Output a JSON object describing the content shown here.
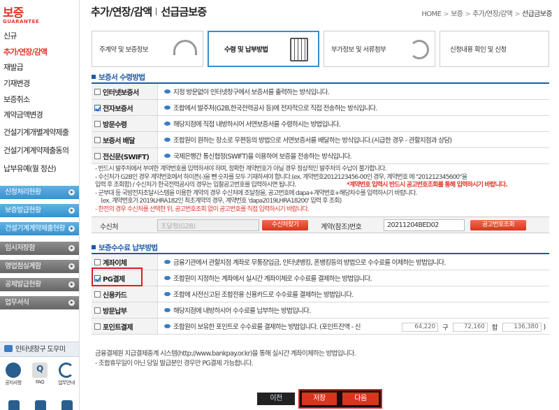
{
  "logo": {
    "main": "보증",
    "sub": "GUARANTEE"
  },
  "nav": [
    {
      "label": "신규",
      "active": false
    },
    {
      "label": "추가/연장/감액",
      "active": true
    },
    {
      "label": "재발급",
      "active": false
    },
    {
      "label": "기재변경",
      "active": false
    },
    {
      "label": "보증취소",
      "active": false
    },
    {
      "label": "계약금액변경",
      "active": false
    },
    {
      "label": "건설기계개별계약제출",
      "active": false
    },
    {
      "label": "건설기계계약제출동의",
      "active": false
    },
    {
      "label": "납부유예(월 정산)",
      "active": false
    }
  ],
  "side_buttons": [
    {
      "label": "신청처리현황",
      "style": "blue"
    },
    {
      "label": "보증발급현황",
      "style": "blue"
    },
    {
      "label": "건설기계계약제출현황",
      "style": "blue"
    },
    {
      "label": "임시저장함",
      "style": "gray"
    },
    {
      "label": "영업점실계함",
      "style": "gray"
    },
    {
      "label": "공제발급현황",
      "style": "gray"
    },
    {
      "label": "업무서식",
      "style": "gray"
    }
  ],
  "help": {
    "title": "인터넷창구 도우미",
    "icons": [
      {
        "label": "공지사항",
        "icon": "notice-icon"
      },
      {
        "label": "FAQ",
        "icon": "faq-icon"
      },
      {
        "label": "업무안내",
        "icon": "guide-icon"
      }
    ]
  },
  "header": {
    "title": "추가/연장/감액",
    "subtitle": "선급금보증",
    "breadcrumb": [
      "HOME",
      "보증",
      "추가/연장/감액",
      "선급금보증"
    ]
  },
  "steps": [
    {
      "label": "주계약 및 보증정보",
      "icon": "headset-icon",
      "current": false
    },
    {
      "label": "수령 및 납부방법",
      "icon": "calculator-icon",
      "current": true
    },
    {
      "label": "부가정보 및 서류첨부",
      "icon": "refresh-arrow-icon",
      "current": false
    },
    {
      "label": "신청내용 확인 및 신청",
      "icon": "",
      "current": false
    }
  ],
  "receipt": {
    "heading": "보증서 수령방법",
    "options": [
      {
        "label": "인터넷보증서",
        "checked": false,
        "desc": "지정 방문없이 인터넷창구에서 보증서를 출력하는 방식입니다."
      },
      {
        "label": "전자보증서",
        "checked": true,
        "desc": "조합에서 발주처(G2B,한국전력공사 등)에 전자적으로 직접 전송하는 방식입니다."
      },
      {
        "label": "방문수령",
        "checked": false,
        "desc": "해당지점에 직접 내방하시어 서면보증서를 수령하시는 방법입니다."
      },
      {
        "label": "보증서 배달",
        "checked": false,
        "desc": "조합원이 원하는 장소로 우편등의 방법으로 서면보증서를 배달하는 방식입니다.(시급한 경우 - 관할지점과 상담)"
      },
      {
        "label": "전신문(SWIFT)",
        "checked": false,
        "desc": "국제은행간 통신협정(SWIFT)을 이용하여 보증을 전송하는 방식입니다."
      }
    ]
  },
  "notes": [
    "- 반드시 발주처에서 부여한 계약번호를 입력하셔야 하며, 정확한 계약번호가 아닐 경우 정상적인 발주처의 수납이 불가합니다.",
    "- 수신처가 G2B인 경우 계약번호에서 하이픈(-)을 뺀 숫자를 모두 기재하셔야 합니다.(ex. 계약번호2012123456-00인 경우, 계약번호 에 \"201212345600\"을",
    "입력 후 조회함) / 수신처가 한국전력공사의 경우는 입찰공고번호를 입력하시면 됩니다.",
    "- 군부대 등 국방전자조달시스템을 이용한 계약의 경우 수신처에 조달청을, 공고번호에 dapa+계약번호+해당차수를 입력하시기 바랍니다.",
    "(ex. 계약번호가 2019LHRA182인 최초계약의 경우, 계약번호 'dapa2019LHRA18200' 입력 후 조회)",
    "- 한전의 경우 수신처를 선택한 뒤, 공고번호조회 없이 공고번호를 직접 입력하시기 바랍니다."
  ],
  "notes_warning": "*계약번호 입력시 반드시 공고번호조회를 통해 입력하시기 바랍니다.",
  "supplier": {
    "label": "수신처",
    "value": "조달청(G2B)",
    "search_button": "수신처찾기",
    "contract_label": "계약(참조)번호",
    "contract_value": "20211204BED02",
    "notice_button": "공고번호조회"
  },
  "payment": {
    "heading": "보증수수료 납부방법",
    "options": [
      {
        "label": "계좌이체",
        "checked": false,
        "desc": "금융기관에서 관할지점 계좌로 무통장입금, 인터넷뱅킹, 폰뱅킹등의 방법으로 수수료를 이체하는 방법입니다."
      },
      {
        "label": "PG결제",
        "checked": true,
        "desc": "조합원이 지정하는 계좌에서 실시간 계좌이체로 수수료를 결제하는 방법입니다."
      },
      {
        "label": "신용카드",
        "checked": false,
        "desc": "조합에 사전신고된 조합전용 신용카드로 수수료를 결제하는 방법입니다."
      },
      {
        "label": "방문납부",
        "checked": false,
        "desc": "해당지점에 내방하시어 수수료를 납부하는 방법입니다."
      },
      {
        "label": "포인트결제",
        "checked": false,
        "desc": "조합원이 보유한 포인트로 수수료를 결제하는 방법입니다. (포인트잔액 - 신"
      }
    ],
    "points": [
      {
        "value": "64,220",
        "label": "구"
      },
      {
        "value": "72,160",
        "label": "합"
      },
      {
        "value": "136,380",
        "label": ")"
      }
    ]
  },
  "footnote": [
    "금융결제원 지급결제중계 시스템(http://www.bankpay.or.kr)을 통해 실시간 계좌이체하는 방법입니다.",
    "- 조합휴무일이 아닌 당일 발급분인 경우만 PG결제 가능합니다."
  ],
  "buttons": {
    "prev": "이전",
    "save": "저장",
    "next": "다음"
  }
}
